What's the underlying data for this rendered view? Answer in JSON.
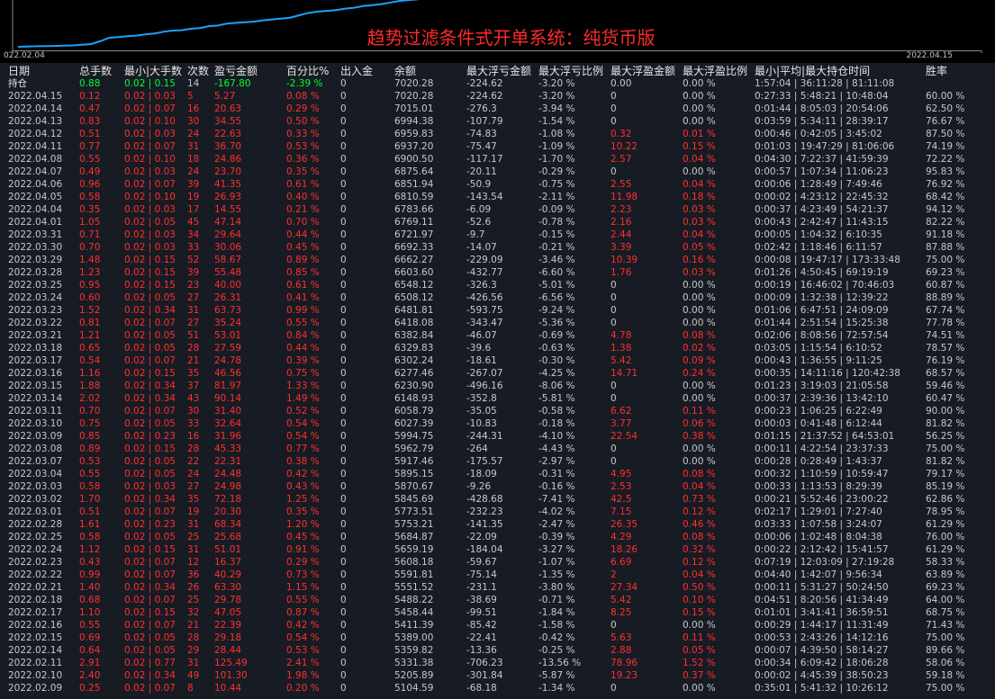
{
  "title": "趋势过滤条件式开单系统：纯货币版",
  "chart": {
    "start_label": "022.02.04",
    "end_label": "2022.04.15",
    "line_color": "#1ea0ff",
    "equity": [
      5010,
      5020,
      5030,
      5035,
      5040,
      5050,
      5060,
      5080,
      5104,
      5205,
      5331,
      5360,
      5389,
      5411,
      5458,
      5488,
      5551,
      5592,
      5608,
      5659,
      5685,
      5753,
      5774,
      5846,
      5871,
      5895,
      5917,
      5963,
      5995,
      6027,
      6059,
      6149,
      6231,
      6277,
      6302,
      6330,
      6383,
      6418,
      6482,
      6508,
      6548,
      6604,
      6662,
      6692,
      6722,
      6769,
      6784,
      6811,
      6852,
      6876,
      6901,
      6937,
      6960,
      6994,
      7015,
      7020
    ]
  },
  "colors": {
    "profit": "#ff3030",
    "positive": "#00ff30",
    "neutral": "#c8c8c8",
    "grid_bg": "#171b23"
  },
  "headers": [
    "日期",
    "总手数",
    "最小|大手数",
    "次数",
    "盈亏金额",
    "百分比%",
    "出入金",
    "余额",
    "最大浮亏金额",
    "最大浮亏比例",
    "最大浮盈金额",
    "最大浮盈比例",
    "最小|平均|最大持仓时间",
    "胜率"
  ],
  "holding": [
    "持仓",
    "0.88",
    "0.02 | 0.15",
    "14",
    "-167.80",
    "-2.39 %",
    "0",
    "7020.28",
    "-224.62",
    "-3.20 %",
    "0.00",
    "0.00 %",
    "1:57:04 | 36:11:28 | 81:11:08",
    ""
  ],
  "rows": [
    [
      "2022.04.15",
      "0.12",
      "0.02 | 0.03",
      "5",
      "5.27",
      "0.08 %",
      "0",
      "7020.28",
      "-224.62",
      "-3.20 %",
      "0",
      "0.00 %",
      "0:27:33 | 5:48:21 | 10:48:04",
      "60.00 %"
    ],
    [
      "2022.04.14",
      "0.47",
      "0.02 | 0.07",
      "16",
      "20.63",
      "0.29 %",
      "0",
      "7015.01",
      "-276.3",
      "-3.94 %",
      "0",
      "0.00 %",
      "0:01:44 | 8:05:03 | 20:54:06",
      "62.50 %"
    ],
    [
      "2022.04.13",
      "0.83",
      "0.02 | 0.10",
      "30",
      "34.55",
      "0.50 %",
      "0",
      "6994.38",
      "-107.79",
      "-1.54 %",
      "0",
      "0.00 %",
      "0:03:59 | 5:34:11 | 28:39:17",
      "76.67 %"
    ],
    [
      "2022.04.12",
      "0.51",
      "0.02 | 0.03",
      "24",
      "22.63",
      "0.33 %",
      "0",
      "6959.83",
      "-74.83",
      "-1.08 %",
      "0.32",
      "0.01 %",
      "0:00:46 | 0:42:05 | 3:45:02",
      "87.50 %"
    ],
    [
      "2022.04.11",
      "0.77",
      "0.02 | 0.07",
      "31",
      "36.70",
      "0.53 %",
      "0",
      "6937.20",
      "-75.47",
      "-1.09 %",
      "10.22",
      "0.15 %",
      "0:01:03 | 19:47:29 | 81:06:06",
      "74.19 %"
    ],
    [
      "2022.04.08",
      "0.55",
      "0.02 | 0.10",
      "18",
      "24.86",
      "0.36 %",
      "0",
      "6900.50",
      "-117.17",
      "-1.70 %",
      "2.57",
      "0.04 %",
      "0:04:30 | 7:22:37 | 41:59:39",
      "72.22 %"
    ],
    [
      "2022.04.07",
      "0.49",
      "0.02 | 0.03",
      "24",
      "23.70",
      "0.35 %",
      "0",
      "6875.64",
      "-20.11",
      "-0.29 %",
      "0",
      "0.00 %",
      "0:00:57 | 1:07:34 | 11:06:23",
      "95.83 %"
    ],
    [
      "2022.04.06",
      "0.96",
      "0.02 | 0.07",
      "39",
      "41.35",
      "0.61 %",
      "0",
      "6851.94",
      "-50.9",
      "-0.75 %",
      "2.55",
      "0.04 %",
      "0:00:06 | 1:28:49 | 7:49:46",
      "76.92 %"
    ],
    [
      "2022.04.05",
      "0.58",
      "0.02 | 0.10",
      "19",
      "26.93",
      "0.40 %",
      "0",
      "6810.59",
      "-143.54",
      "-2.11 %",
      "11.98",
      "0.18 %",
      "0:00:02 | 4:23:12 | 22:45:32",
      "68.42 %"
    ],
    [
      "2022.04.04",
      "0.35",
      "0.02 | 0.03",
      "17",
      "14.55",
      "0.21 %",
      "0",
      "6783.66",
      "-6.09",
      "-0.09 %",
      "2.23",
      "0.03 %",
      "0:00:37 | 4:23:49 | 54:21:37",
      "94.12 %"
    ],
    [
      "2022.04.01",
      "1.05",
      "0.02 | 0.05",
      "45",
      "47.14",
      "0.70 %",
      "0",
      "6769.11",
      "-52.6",
      "-0.78 %",
      "2.16",
      "0.03 %",
      "0:00:43 | 2:42:47 | 11:43:15",
      "82.22 %"
    ],
    [
      "2022.03.31",
      "0.71",
      "0.02 | 0.03",
      "34",
      "29.64",
      "0.44 %",
      "0",
      "6721.97",
      "-9.7",
      "-0.15 %",
      "2.44",
      "0.04 %",
      "0:00:05 | 1:04:32 | 6:10:35",
      "91.18 %"
    ],
    [
      "2022.03.30",
      "0.70",
      "0.02 | 0.03",
      "33",
      "30.06",
      "0.45 %",
      "0",
      "6692.33",
      "-14.07",
      "-0.21 %",
      "3.39",
      "0.05 %",
      "0:02:42 | 1:18:46 | 6:11:57",
      "87.88 %"
    ],
    [
      "2022.03.29",
      "1.48",
      "0.02 | 0.15",
      "52",
      "58.67",
      "0.89 %",
      "0",
      "6662.27",
      "-229.09",
      "-3.46 %",
      "10.39",
      "0.16 %",
      "0:00:08 | 19:47:17 | 173:33:48",
      "75.00 %"
    ],
    [
      "2022.03.28",
      "1.23",
      "0.02 | 0.15",
      "39",
      "55.48",
      "0.85 %",
      "0",
      "6603.60",
      "-432.77",
      "-6.60 %",
      "1.76",
      "0.03 %",
      "0:01:26 | 4:50:45 | 69:19:19",
      "69.23 %"
    ],
    [
      "2022.03.25",
      "0.95",
      "0.02 | 0.15",
      "23",
      "40.00",
      "0.61 %",
      "0",
      "6548.12",
      "-326.3",
      "-5.01 %",
      "0",
      "0.00 %",
      "0:00:19 | 16:46:02 | 70:46:03",
      "60.87 %"
    ],
    [
      "2022.03.24",
      "0.60",
      "0.02 | 0.05",
      "27",
      "26.31",
      "0.41 %",
      "0",
      "6508.12",
      "-426.56",
      "-6.56 %",
      "0",
      "0.00 %",
      "0:00:09 | 1:32:38 | 12:39:22",
      "88.89 %"
    ],
    [
      "2022.03.23",
      "1.52",
      "0.02 | 0.34",
      "31",
      "63.73",
      "0.99 %",
      "0",
      "6481.81",
      "-593.75",
      "-9.24 %",
      "0",
      "0.00 %",
      "0:01:06 | 6:47:51 | 24:09:09",
      "67.74 %"
    ],
    [
      "2022.03.22",
      "0.81",
      "0.02 | 0.07",
      "27",
      "35.24",
      "0.55 %",
      "0",
      "6418.08",
      "-343.47",
      "-5.36 %",
      "0",
      "0.00 %",
      "0:01:44 | 2:51:54 | 15:25:38",
      "77.78 %"
    ],
    [
      "2022.03.21",
      "1.21",
      "0.02 | 0.05",
      "51",
      "53.01",
      "0.84 %",
      "0",
      "6382.84",
      "-46.07",
      "-0.69 %",
      "4.78",
      "0.08 %",
      "0:02:06 | 8:08:56 | 72:57:54",
      "74.51 %"
    ],
    [
      "2022.03.18",
      "0.65",
      "0.02 | 0.05",
      "28",
      "27.59",
      "0.44 %",
      "0",
      "6329.83",
      "-39.6",
      "-0.63 %",
      "1.38",
      "0.02 %",
      "0:03:05 | 1:15:54 | 6:10:52",
      "78.57 %"
    ],
    [
      "2022.03.17",
      "0.54",
      "0.02 | 0.07",
      "21",
      "24.78",
      "0.39 %",
      "0",
      "6302.24",
      "-18.61",
      "-0.30 %",
      "5.42",
      "0.09 %",
      "0:00:43 | 1:36:55 | 9:11:25",
      "76.19 %"
    ],
    [
      "2022.03.16",
      "1.16",
      "0.02 | 0.15",
      "35",
      "46.56",
      "0.75 %",
      "0",
      "6277.46",
      "-267.07",
      "-4.25 %",
      "14.71",
      "0.24 %",
      "0:00:35 | 14:11:16 | 120:42:38",
      "68.57 %"
    ],
    [
      "2022.03.15",
      "1.88",
      "0.02 | 0.34",
      "37",
      "81.97",
      "1.33 %",
      "0",
      "6230.90",
      "-496.16",
      "-8.06 %",
      "0",
      "0.00 %",
      "0:01:23 | 3:19:03 | 21:05:58",
      "59.46 %"
    ],
    [
      "2022.03.14",
      "2.02",
      "0.02 | 0.34",
      "43",
      "90.14",
      "1.49 %",
      "0",
      "6148.93",
      "-352.8",
      "-5.81 %",
      "0",
      "0.00 %",
      "0:00:37 | 2:39:36 | 13:42:10",
      "60.47 %"
    ],
    [
      "2022.03.11",
      "0.70",
      "0.02 | 0.07",
      "30",
      "31.40",
      "0.52 %",
      "0",
      "6058.79",
      "-35.05",
      "-0.58 %",
      "6.62",
      "0.11 %",
      "0:00:23 | 1:06:25 | 6:22:49",
      "90.00 %"
    ],
    [
      "2022.03.10",
      "0.75",
      "0.02 | 0.05",
      "33",
      "32.64",
      "0.54 %",
      "0",
      "6027.39",
      "-10.83",
      "-0.18 %",
      "3.77",
      "0.06 %",
      "0:00:03 | 0:41:48 | 6:12:44",
      "81.82 %"
    ],
    [
      "2022.03.09",
      "0.85",
      "0.02 | 0.23",
      "16",
      "31.96",
      "0.54 %",
      "0",
      "5994.75",
      "-244.31",
      "-4.10 %",
      "22.54",
      "0.38 %",
      "0:01:15 | 21:37:52 | 64:53:01",
      "56.25 %"
    ],
    [
      "2022.03.08",
      "0.89",
      "0.02 | 0.15",
      "28",
      "45.33",
      "0.77 %",
      "0",
      "5962.79",
      "-264",
      "-4.43 %",
      "0",
      "0.00 %",
      "0:00:11 | 4:22:54 | 23:37:33",
      "75.00 %"
    ],
    [
      "2022.03.07",
      "0.53",
      "0.02 | 0.05",
      "22",
      "22.31",
      "0.38 %",
      "0",
      "5917.46",
      "-175.57",
      "-2.97 %",
      "0",
      "0.00 %",
      "0:00:28 | 0:28:49 | 1:43:37",
      "81.82 %"
    ],
    [
      "2022.03.04",
      "0.55",
      "0.02 | 0.05",
      "24",
      "24.48",
      "0.42 %",
      "0",
      "5895.15",
      "-18.09",
      "-0.31 %",
      "4.95",
      "0.08 %",
      "0:00:32 | 1:10:59 | 10:59:47",
      "79.17 %"
    ],
    [
      "2022.03.03",
      "0.58",
      "0.02 | 0.03",
      "27",
      "24.98",
      "0.43 %",
      "0",
      "5870.67",
      "-9.26",
      "-0.16 %",
      "2.53",
      "0.04 %",
      "0:00:33 | 1:13:53 | 8:29:39",
      "85.19 %"
    ],
    [
      "2022.03.02",
      "1.70",
      "0.02 | 0.34",
      "35",
      "72.18",
      "1.25 %",
      "0",
      "5845.69",
      "-428.68",
      "-7.41 %",
      "42.5",
      "0.73 %",
      "0:00:21 | 5:52:46 | 23:00:22",
      "62.86 %"
    ],
    [
      "2022.03.01",
      "0.51",
      "0.02 | 0.07",
      "19",
      "20.30",
      "0.35 %",
      "0",
      "5773.51",
      "-232.23",
      "-4.02 %",
      "7.15",
      "0.12 %",
      "0:02:17 | 1:29:01 | 7:27:40",
      "78.95 %"
    ],
    [
      "2022.02.28",
      "1.61",
      "0.02 | 0.23",
      "31",
      "68.34",
      "1.20 %",
      "0",
      "5753.21",
      "-141.35",
      "-2.47 %",
      "26.35",
      "0.46 %",
      "0:03:33 | 1:07:58 | 3:24:07",
      "61.29 %"
    ],
    [
      "2022.02.25",
      "0.58",
      "0.02 | 0.05",
      "25",
      "25.68",
      "0.45 %",
      "0",
      "5684.87",
      "-22.09",
      "-0.39 %",
      "4.29",
      "0.08 %",
      "0:00:06 | 1:02:48 | 8:04:38",
      "76.00 %"
    ],
    [
      "2022.02.24",
      "1.12",
      "0.02 | 0.15",
      "31",
      "51.01",
      "0.91 %",
      "0",
      "5659.19",
      "-184.04",
      "-3.27 %",
      "18.26",
      "0.32 %",
      "0:00:22 | 2:12:42 | 15:41:57",
      "61.29 %"
    ],
    [
      "2022.02.23",
      "0.43",
      "0.02 | 0.07",
      "12",
      "16.37",
      "0.29 %",
      "0",
      "5608.18",
      "-59.67",
      "-1.07 %",
      "6.69",
      "0.12 %",
      "0:07:19 | 12:03:09 | 27:19:28",
      "58.33 %"
    ],
    [
      "2022.02.22",
      "0.99",
      "0.02 | 0.07",
      "36",
      "40.29",
      "0.73 %",
      "0",
      "5591.81",
      "-75.14",
      "-1.35 %",
      "2",
      "0.04 %",
      "0:04:40 | 1:42:07 | 9:56:34",
      "63.89 %"
    ],
    [
      "2022.02.21",
      "1.40",
      "0.02 | 0.34",
      "26",
      "63.30",
      "1.15 %",
      "0",
      "5551.52",
      "-231.1",
      "-3.80 %",
      "27.34",
      "0.50 %",
      "0:00:11 | 5:31:27 | 50:24:50",
      "69.23 %"
    ],
    [
      "2022.02.18",
      "0.68",
      "0.02 | 0.07",
      "25",
      "29.78",
      "0.55 %",
      "0",
      "5488.22",
      "-38.69",
      "-0.71 %",
      "5.42",
      "0.10 %",
      "0:04:51 | 8:20:56 | 41:34:49",
      "64.00 %"
    ],
    [
      "2022.02.17",
      "1.10",
      "0.02 | 0.15",
      "32",
      "47.05",
      "0.87 %",
      "0",
      "5458.44",
      "-99.51",
      "-1.84 %",
      "8.25",
      "0.15 %",
      "0:01:01 | 3:41:41 | 36:59:51",
      "68.75 %"
    ],
    [
      "2022.02.16",
      "0.55",
      "0.02 | 0.07",
      "21",
      "22.39",
      "0.42 %",
      "0",
      "5411.39",
      "-85.42",
      "-1.58 %",
      "0",
      "0.00 %",
      "0:00:29 | 1:44:17 | 11:31:49",
      "71.43 %"
    ],
    [
      "2022.02.15",
      "0.69",
      "0.02 | 0.05",
      "28",
      "29.18",
      "0.54 %",
      "0",
      "5389.00",
      "-22.41",
      "-0.42 %",
      "5.63",
      "0.11 %",
      "0:00:53 | 2:43:26 | 14:12:16",
      "75.00 %"
    ],
    [
      "2022.02.14",
      "0.64",
      "0.02 | 0.05",
      "29",
      "28.44",
      "0.53 %",
      "0",
      "5359.82",
      "-13.36",
      "-0.25 %",
      "2.88",
      "0.05 %",
      "0:00:07 | 4:39:50 | 58:14:27",
      "89.66 %"
    ],
    [
      "2022.02.11",
      "2.91",
      "0.02 | 0.77",
      "31",
      "125.49",
      "2.41 %",
      "0",
      "5331.38",
      "-706.23",
      "-13.56 %",
      "78.96",
      "1.52 %",
      "0:00:34 | 6:09:42 | 18:06:28",
      "58.06 %"
    ],
    [
      "2022.02.10",
      "2.40",
      "0.02 | 0.34",
      "49",
      "101.30",
      "1.98 %",
      "0",
      "5205.89",
      "-301.84",
      "-5.87 %",
      "19.23",
      "0.37 %",
      "0:00:02 | 4:45:39 | 38:50:23",
      "59.18 %"
    ],
    [
      "2022.02.09",
      "0.25",
      "0.02 | 0.07",
      "8",
      "10.44",
      "0.20 %",
      "0",
      "5104.59",
      "-68.18",
      "-1.34 %",
      "0",
      "0.00 %",
      "0:35:01 | 5:41:32 | 10:26:12",
      "75.00 %"
    ]
  ]
}
